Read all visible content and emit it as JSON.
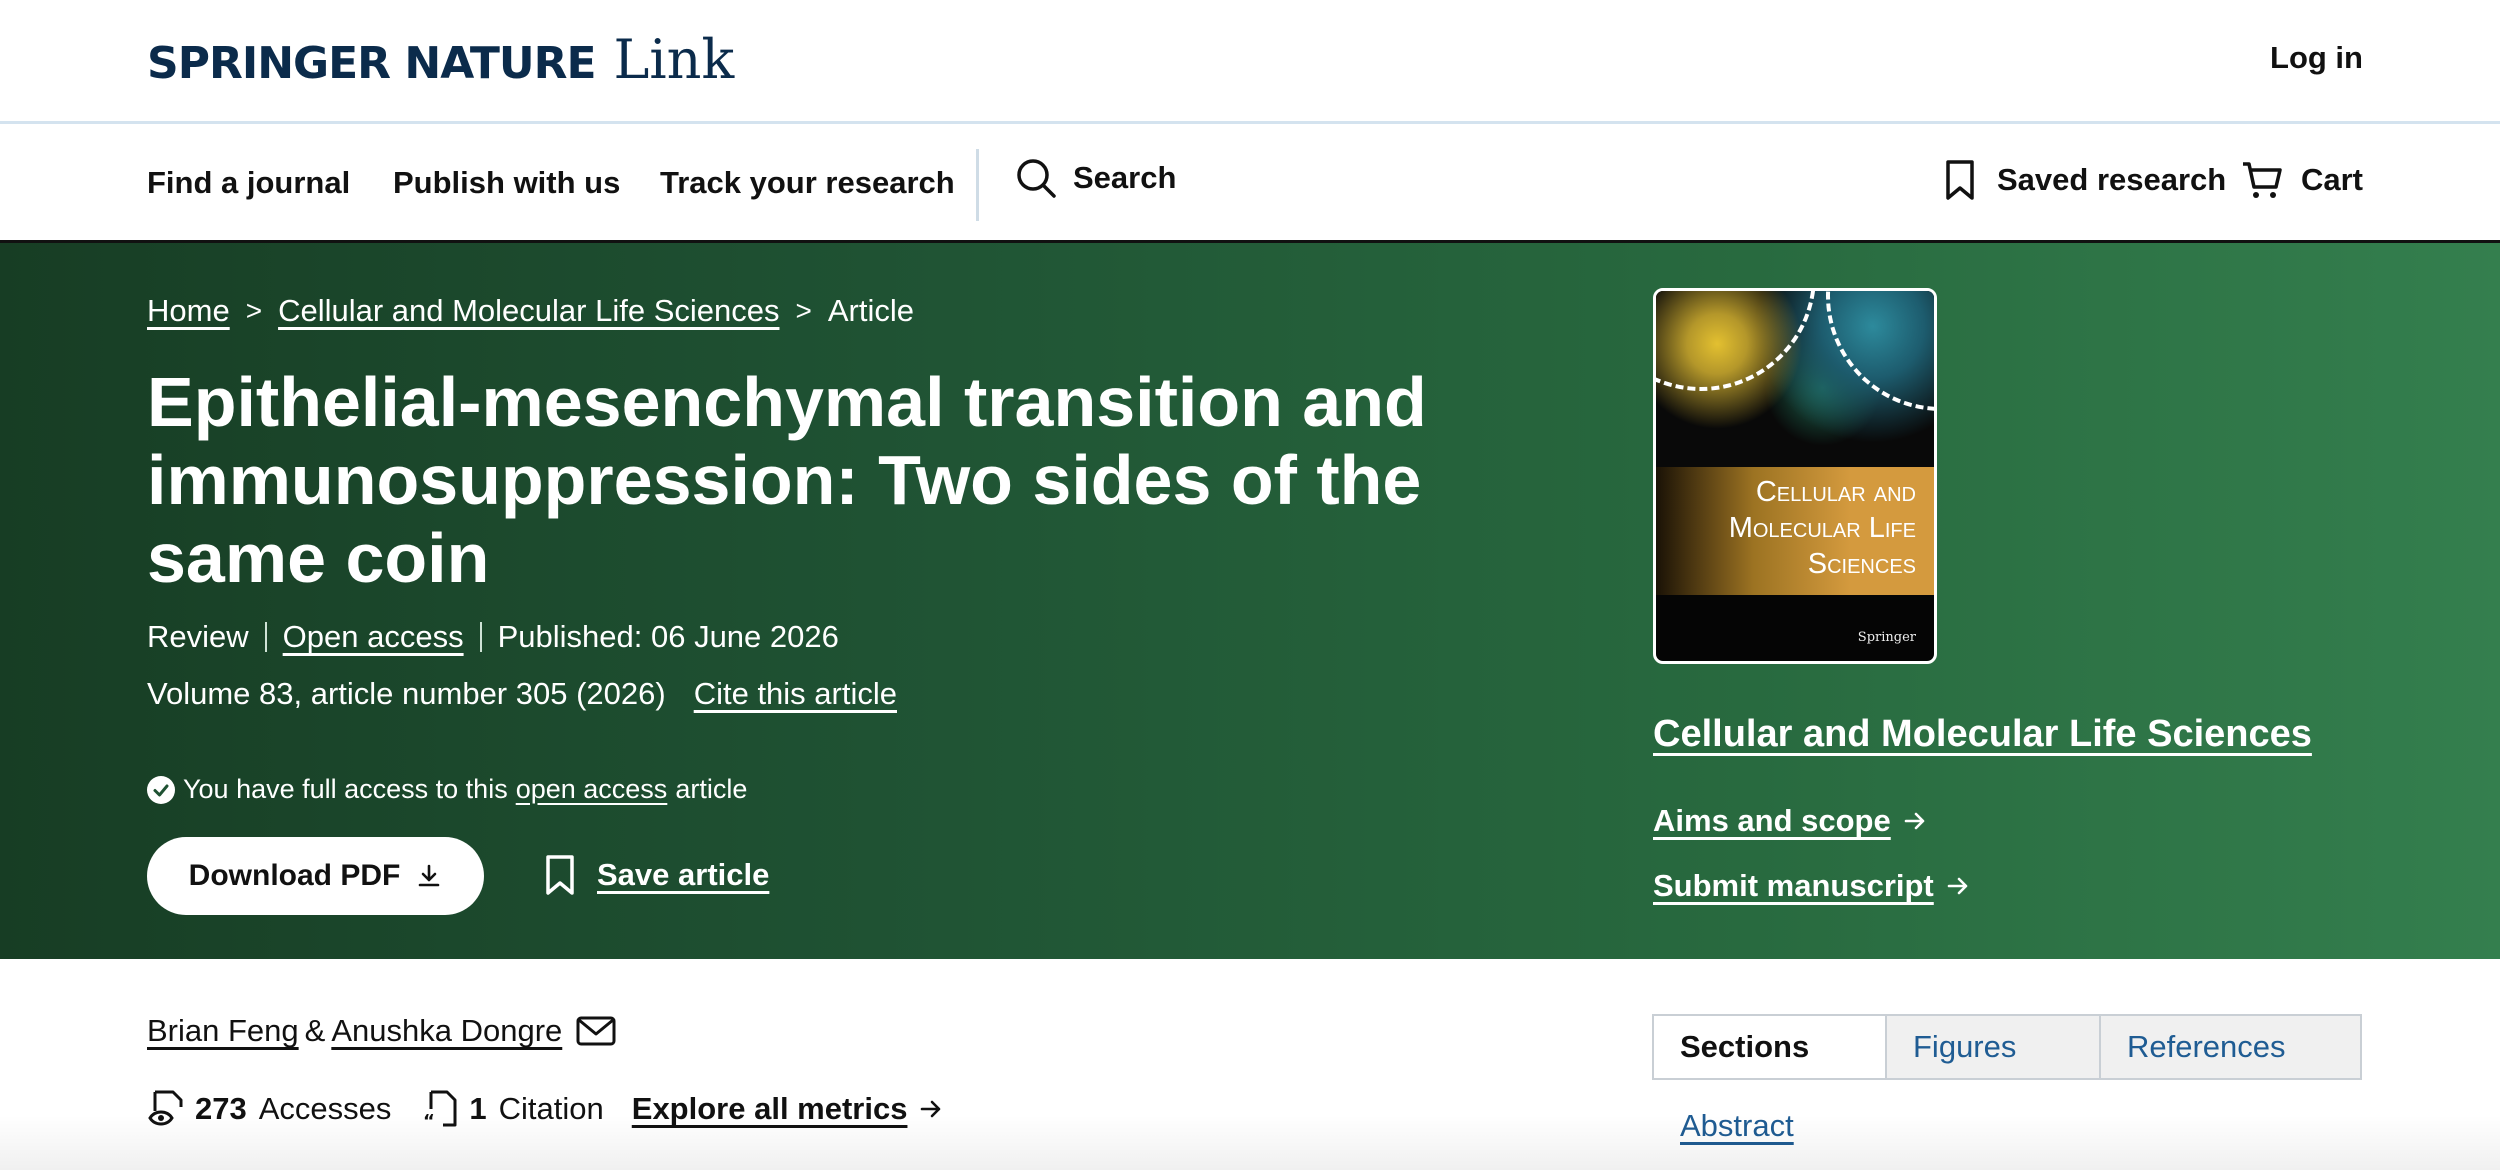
{
  "header": {
    "brand": "SPRINGER NATURE",
    "product": "Link",
    "login_label": "Log in"
  },
  "nav": {
    "items": [
      "Find a journal",
      "Publish with us",
      "Track your research"
    ],
    "search_label": "Search",
    "saved_label": "Saved research",
    "cart_label": "Cart"
  },
  "breadcrumb": {
    "home": "Home",
    "journal": "Cellular and Molecular Life Sciences",
    "current": "Article",
    "separator": ">"
  },
  "article": {
    "title": "Epithelial-mesenchymal transition and immunosuppression: Two sides of the same coin",
    "type": "Review",
    "open_access": "Open access",
    "published": "Published: 06 June 2026",
    "volume": "Volume 83, article number 305 (2026)",
    "cite_label": "Cite this article",
    "access_prefix": "You have full access to this",
    "access_link": "open access",
    "access_suffix": "article",
    "download_label": "Download PDF",
    "save_label": "Save article"
  },
  "journal": {
    "cover_lines": [
      "Cellular and",
      "Molecular Life",
      "Sciences"
    ],
    "cover_publisher": "Springer",
    "title": "Cellular and Molecular Life Sciences",
    "aims_label": "Aims and scope",
    "submit_label": "Submit manuscript"
  },
  "authors": {
    "author1": "Brian Feng",
    "joiner": "&",
    "author2": "Anushka Dongre"
  },
  "metrics": {
    "accesses_value": "273",
    "accesses_label": "Accesses",
    "citations_value": "1",
    "citations_label": "Citation",
    "explore_label": "Explore all metrics"
  },
  "sidebar_tabs": {
    "tabs": [
      "Sections",
      "Figures",
      "References"
    ],
    "active": "Sections",
    "first_section": "Abstract"
  },
  "colors": {
    "brand_navy": "#0b2b4b",
    "hero_green_dark": "#173d24",
    "hero_green_light": "#347f4e",
    "link_blue": "#1f5c93"
  }
}
